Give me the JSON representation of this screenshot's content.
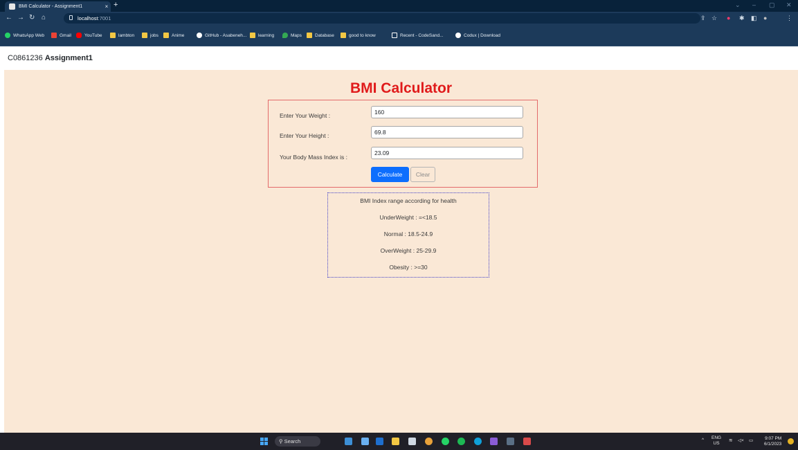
{
  "browser": {
    "tab_title": "BMI Calculator - Assignment1",
    "tab_close": "×",
    "new_tab": "+",
    "url_host": "localhost",
    "url_port": ":7001",
    "window_controls": [
      "⌄",
      "–",
      "▢",
      "✕"
    ]
  },
  "bookmarks": [
    {
      "label": "WhatsApp Web",
      "color": "#25d366"
    },
    {
      "label": "Gmail",
      "color": "#ea4335"
    },
    {
      "label": "YouTube",
      "color": "#ff0000"
    },
    {
      "label": "lambton",
      "color": "#f2c744"
    },
    {
      "label": "jobs",
      "color": "#f2c744"
    },
    {
      "label": "Anime",
      "color": "#f2c744"
    },
    {
      "label": "GitHub - Asabeneh...",
      "color": "#ffffff"
    },
    {
      "label": "learning",
      "color": "#f2c744"
    },
    {
      "label": "Maps",
      "color": "#34a853"
    },
    {
      "label": "Database",
      "color": "#f2c744"
    },
    {
      "label": "good to know",
      "color": "#f2c744"
    },
    {
      "label": "Recent - CodeSand...",
      "color": "#ffffff"
    },
    {
      "label": "Codux | Download",
      "color": "#ffffff"
    }
  ],
  "page": {
    "student_id": "C0861236",
    "assignment": "Assignment1"
  },
  "calculator": {
    "heading": "BMI Calculator",
    "weight_label": "Enter Your Weight :",
    "weight_value": "160",
    "height_label": "Enter Your Height :",
    "height_value": "69.8",
    "bmi_label": "Your Body Mass Index is :",
    "bmi_value": "23.09",
    "calculate_label": "Calculate",
    "clear_label": "Clear"
  },
  "ranges": {
    "title": "BMI Index range according for health",
    "items": [
      "UnderWeight : =<18.5",
      "Normal : 18.5-24.9",
      "OverWeight : 25-29.9",
      "Obesity : >=30"
    ]
  },
  "taskbar": {
    "search_label": "Search",
    "lang": "ENG",
    "region": "US",
    "time": "9:07 PM",
    "date": "6/1/2023",
    "notification_count": "1"
  },
  "colors": {
    "page_bg": "#fae8d6",
    "heading": "#e01b1b",
    "primary_button": "#0d6efd",
    "browser_frame": "#1c3a5a"
  }
}
